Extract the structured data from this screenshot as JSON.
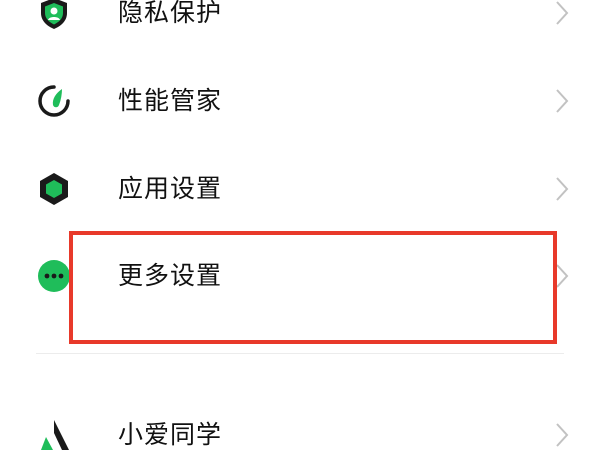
{
  "colors": {
    "accent": "#1fbd5a",
    "icon_dark": "#1a1a1a",
    "highlight_border": "#e8392a",
    "chevron": "#c2c2c2"
  },
  "settings": {
    "items": [
      {
        "label": "隐私保护",
        "icon": "privacy-shield-icon"
      },
      {
        "label": "性能管家",
        "icon": "performance-gauge-icon"
      },
      {
        "label": "应用设置",
        "icon": "app-hexagon-icon"
      },
      {
        "label": "更多设置",
        "icon": "more-dots-icon"
      },
      {
        "label": "小爱同学",
        "icon": "xiaoai-assistant-icon"
      }
    ]
  }
}
